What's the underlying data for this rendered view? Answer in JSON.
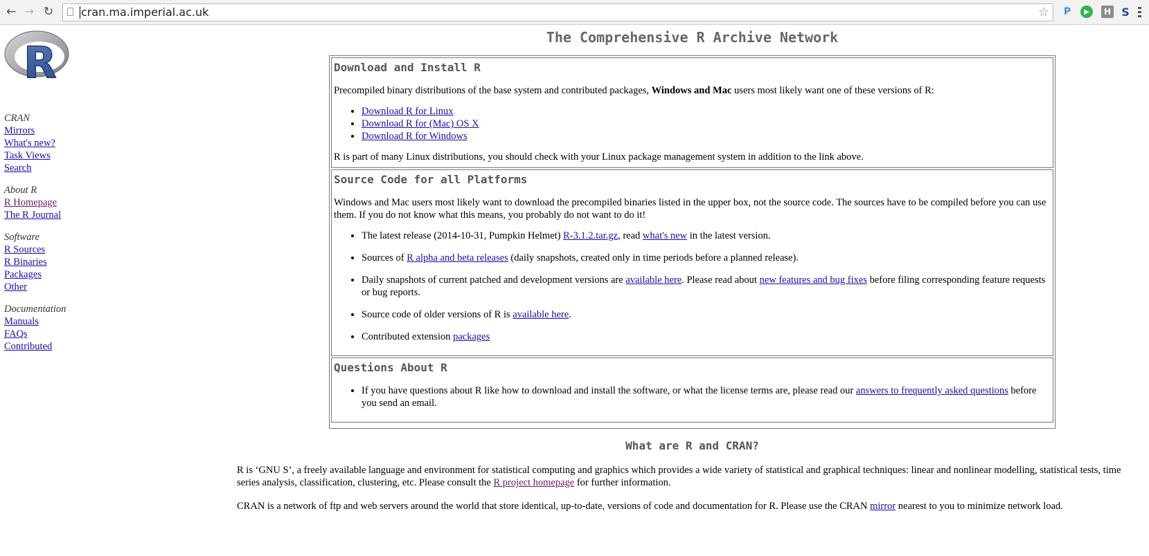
{
  "browser": {
    "url": "cran.ma.imperial.ac.uk",
    "extensions": [
      "P",
      "▶",
      "H",
      "S"
    ]
  },
  "logo_alt": "R",
  "sidebar": [
    {
      "heading": "CRAN",
      "links": [
        {
          "label": "Mirrors",
          "visited": false
        },
        {
          "label": "What's new?",
          "visited": false
        },
        {
          "label": "Task Views",
          "visited": false
        },
        {
          "label": "Search",
          "visited": false
        }
      ]
    },
    {
      "heading": "About R",
      "links": [
        {
          "label": "R Homepage",
          "visited": true
        },
        {
          "label": "The R Journal",
          "visited": false
        }
      ]
    },
    {
      "heading": "Software",
      "links": [
        {
          "label": "R Sources",
          "visited": false
        },
        {
          "label": "R Binaries",
          "visited": false
        },
        {
          "label": "Packages",
          "visited": false
        },
        {
          "label": "Other",
          "visited": false
        }
      ]
    },
    {
      "heading": "Documentation",
      "links": [
        {
          "label": "Manuals",
          "visited": false
        },
        {
          "label": "FAQs",
          "visited": false
        },
        {
          "label": "Contributed",
          "visited": false
        }
      ]
    }
  ],
  "main": {
    "title": "The Comprehensive R Archive Network",
    "download": {
      "heading": "Download and Install R",
      "intro_pre": "Precompiled binary distributions of the base system and contributed packages, ",
      "intro_bold": "Windows and Mac",
      "intro_post": " users most likely want one of these versions of R:",
      "links": [
        "Download R for Linux",
        "Download R for (Mac) OS X",
        "Download R for Windows"
      ],
      "footer": "R is part of many Linux distributions, you should check with your Linux package management system in addition to the link above."
    },
    "source": {
      "heading": "Source Code for all Platforms",
      "intro": "Windows and Mac users most likely want to download the precompiled binaries listed in the upper box, not the source code. The sources have to be compiled before you can use them. If you do not know what this means, you probably do not want to do it!",
      "item1": {
        "pre": "The latest release (2014-10-31, Pumpkin Helmet) ",
        "link1": "R-3.1.2.tar.gz",
        "mid": ", read ",
        "link2": "what's new",
        "post": " in the latest version."
      },
      "item2": {
        "pre": "Sources of ",
        "link": "R alpha and beta releases",
        "post": " (daily snapshots, created only in time periods before a planned release)."
      },
      "item3": {
        "pre": "Daily snapshots of current patched and development versions are ",
        "link1": "available here",
        "mid": ". Please read about ",
        "link2": "new features and bug fixes",
        "post": " before filing corresponding feature requests or bug reports."
      },
      "item4": {
        "pre": "Source code of older versions of R is ",
        "link": "available here",
        "post": "."
      },
      "item5": {
        "pre": "Contributed extension ",
        "link": "packages"
      }
    },
    "questions": {
      "heading": "Questions About R",
      "item": {
        "pre": "If you have questions about R like how to download and install the software, or what the license terms are, please read our ",
        "link": "answers to frequently asked questions",
        "post": " before you send an email."
      }
    },
    "what": {
      "title": "What are R and CRAN?",
      "p1_pre": "R is ‘GNU S’, a freely available language and environment for statistical computing and graphics which provides a wide variety of statistical and graphical techniques: linear and nonlinear modelling, statistical tests, time series analysis, classification, clustering, etc. Please consult the ",
      "p1_link": "R project homepage",
      "p1_post": " for further information.",
      "p2_pre": "CRAN is a network of ftp and web servers around the world that store identical, up-to-date, versions of code and documentation for R. Please use the CRAN ",
      "p2_link": "mirror",
      "p2_post": " nearest to you to minimize network load."
    }
  }
}
